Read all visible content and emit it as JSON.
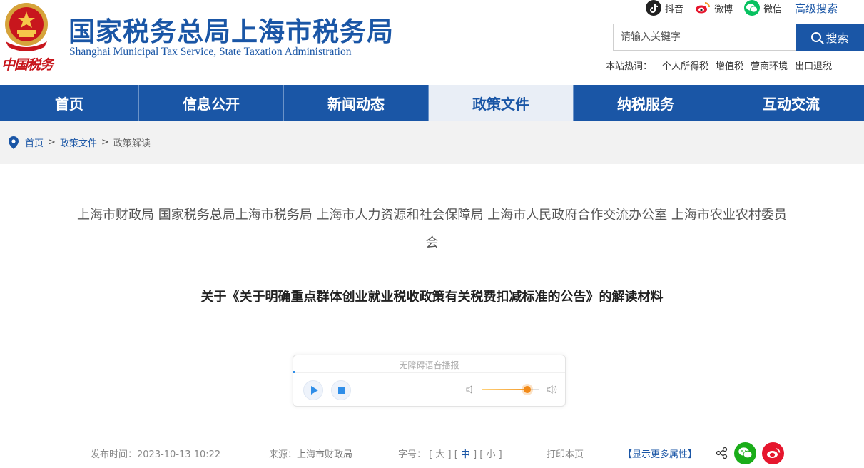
{
  "header": {
    "title": "国家税务总局上海市税务局",
    "subtitle": "Shanghai Municipal Tax Service, State Taxation Administration",
    "seal_text": "中国税务",
    "social": [
      {
        "label": "抖音",
        "icon": "douyin-icon"
      },
      {
        "label": "微博",
        "icon": "weibo-icon"
      },
      {
        "label": "微信",
        "icon": "wechat-icon"
      }
    ],
    "advanced_search": "高级搜索",
    "search": {
      "placeholder": "请输入关键字",
      "button": "搜索"
    },
    "hotwords_label": "本站热词：",
    "hotwords": [
      "个人所得税",
      "增值税",
      "营商环境",
      "出口退税"
    ]
  },
  "nav": {
    "items": [
      "首页",
      "信息公开",
      "新闻动态",
      "政策文件",
      "纳税服务",
      "互动交流"
    ],
    "active": "政策文件"
  },
  "breadcrumb": {
    "items": [
      "首页",
      "政策文件"
    ],
    "current": "政策解读",
    "separator": ">"
  },
  "article": {
    "issuer": "上海市财政局 国家税务总局上海市税务局 上海市人力资源和社会保障局 上海市人民政府合作交流办公室 上海市农业农村委员会",
    "title": "关于《关于明确重点群体创业就业税收政策有关税费扣减标准的公告》的解读材料"
  },
  "player": {
    "label": "无障碍语音播报",
    "volume": 0.8
  },
  "meta": {
    "time_label": "发布时间：",
    "time": "2023-10-13 10:22",
    "source_label": "来源：",
    "source": "上海市财政局",
    "size_label": "字号：",
    "size_large": "大",
    "size_medium": "中",
    "size_small": "小",
    "print": "打印本页",
    "more": "【显示更多属性】"
  },
  "colors": {
    "brand": "#1a56a6",
    "active_nav_bg": "#e9eef6",
    "wechat": "#1aad19",
    "weibo": "#e6162d"
  }
}
